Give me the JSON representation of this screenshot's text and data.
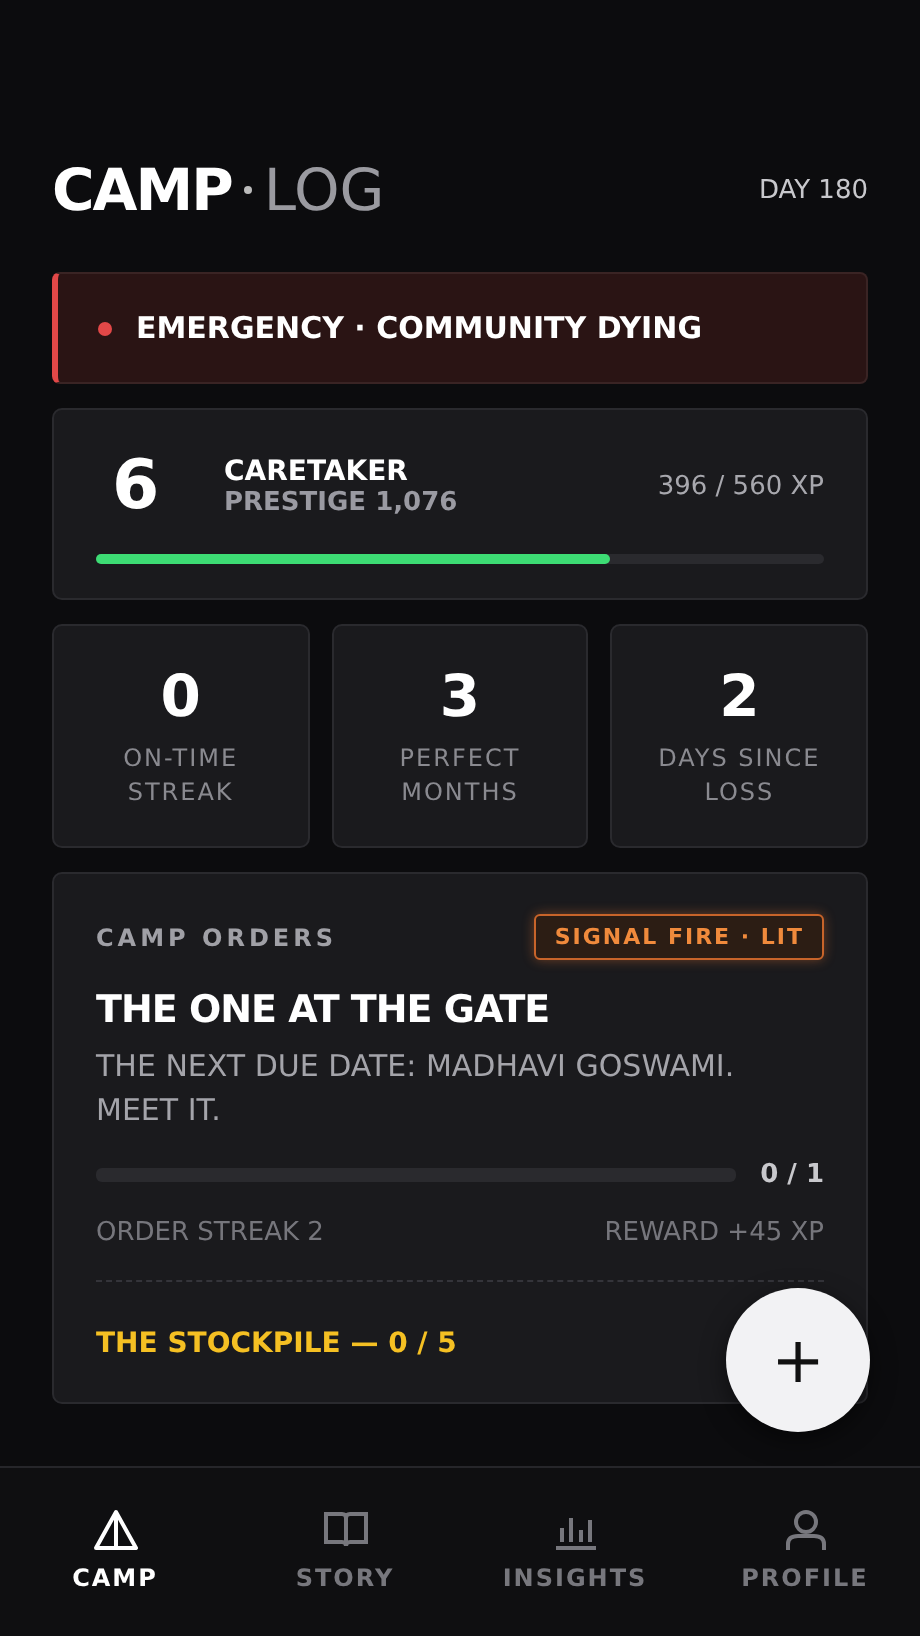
{
  "header": {
    "brand": "CAMP",
    "brand_suffix": "LOG",
    "day": "DAY 180"
  },
  "alert": {
    "text": "EMERGENCY · COMMUNITY DYING"
  },
  "level_card": {
    "level": "6",
    "title": "CARETAKER",
    "prestige": "PRESTIGE 1,076",
    "xp": "396 / 560 XP",
    "progress": {
      "level": 0.707
    }
  },
  "stats": [
    {
      "value": "0",
      "label": "ON-TIME STREAK"
    },
    {
      "value": "3",
      "label": "PERFECT MONTHS"
    },
    {
      "value": "2",
      "label": "DAYS SINCE LOSS"
    }
  ],
  "orders": {
    "heading": "CAMP ORDERS",
    "badge": "SIGNAL FIRE · LIT",
    "title": "THE ONE AT THE GATE",
    "description": "THE NEXT DUE DATE: MADHAVI GOSWAMI. MEET IT.",
    "count": "0 / 1",
    "streak": "ORDER STREAK 2",
    "reward": "REWARD +45 XP",
    "stockpile": "THE STOCKPILE — 0 / 5"
  },
  "fab": {
    "symbol": "+"
  },
  "nav": [
    {
      "kind": "camp",
      "label": "CAMP",
      "selected": true
    },
    {
      "kind": "story",
      "label": "STORY",
      "selected": false
    },
    {
      "kind": "insights",
      "label": "INSIGHTS",
      "selected": false
    },
    {
      "kind": "profile",
      "label": "PROFILE",
      "selected": false
    }
  ]
}
